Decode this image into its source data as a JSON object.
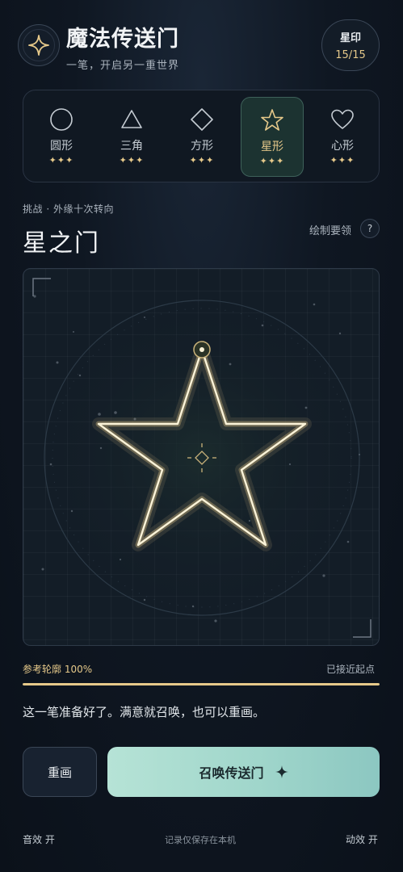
{
  "header": {
    "title": "魔法传送门",
    "subtitle": "一笔，开启另一重世界",
    "badge_label": "星印",
    "badge_count": "15/15"
  },
  "tabs": [
    {
      "label": "圆形",
      "stars": "✦✦✦",
      "icon": "circle-icon",
      "active": false
    },
    {
      "label": "三角",
      "stars": "✦✦✦",
      "icon": "triangle-icon",
      "active": false
    },
    {
      "label": "方形",
      "stars": "✦✦✦",
      "icon": "diamond-icon",
      "active": false
    },
    {
      "label": "星形",
      "stars": "✦✦✦",
      "icon": "star-icon",
      "active": true
    },
    {
      "label": "心形",
      "stars": "✦✦✦",
      "icon": "heart-icon",
      "active": false
    }
  ],
  "challenge": {
    "kicker": "挑战 · 外缘十次转向",
    "title": "星之门",
    "guide_label": "绘制要领",
    "help_glyph": "?"
  },
  "progress": {
    "label": "参考轮廓 100%",
    "value": 1.0,
    "status": "已接近起点"
  },
  "hint": "这一笔准备好了。满意就召唤，也可以重画。",
  "buttons": {
    "redraw": "重画",
    "summon": "召唤传送门",
    "summon_icon": "sparkle-icon"
  },
  "footer": {
    "sound": "音效 开",
    "note": "记录仅保存在本机",
    "motion": "动效 开"
  },
  "colors": {
    "accent_gold": "#e6c98a",
    "accent_teal": "#a0d6cb",
    "background": "#0f1722"
  }
}
